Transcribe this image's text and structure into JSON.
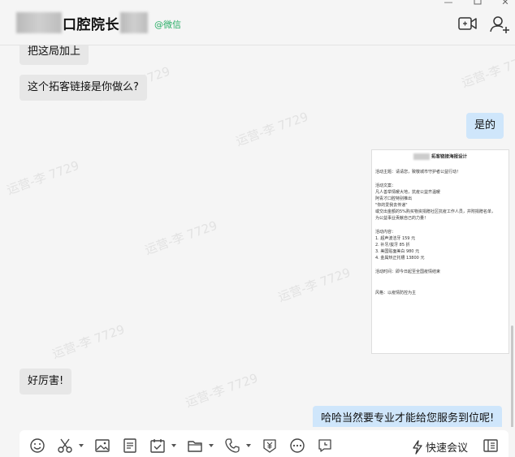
{
  "header": {
    "title": "口腔院长",
    "source_tag": "@微信"
  },
  "messages": [
    {
      "side": "left",
      "text": "把这局加上"
    },
    {
      "side": "left",
      "text": "这个拓客链接是你做么?"
    },
    {
      "side": "right",
      "text": "是的"
    },
    {
      "side": "left",
      "text": "好厉害!"
    },
    {
      "side": "right",
      "text": "哈哈当然要专业才能给您服务到位呢!"
    }
  ],
  "watermark_text": "运营-李 7729",
  "poster": {
    "title": "拓客链接海报设计",
    "theme": "活动主题：请请您，致敬城市守护者公益行动！",
    "copy_label": "活动文案：",
    "copy_lines": [
      "凡人善举情暖大地，抗疫公益齐温暖",
      "阿青才口腔特别推出",
      "\"你的爱我去传递\"",
      "或交出金额的5%购买物资捐赠社区抗疫工作人员，并附捐赠名单，",
      "为公益事业贡献自己的力量！"
    ],
    "content_label": "活动内容：",
    "items": [
      "1. 超声波洁牙   159 元",
      "2. 补牙/拔牙   85 折",
      "3. 美国贴面美白 980 元",
      "4. 金属矫正托槽   13800 元"
    ],
    "time": "活动时间：即今日起至全国疫情结束",
    "style": "风格：以疫情防控为主"
  },
  "toolbar": {
    "meeting_label": "快速会议",
    "icons": [
      "emoji-icon",
      "scissors-icon",
      "image-icon",
      "document-icon",
      "calendar-check-icon",
      "folder-icon",
      "phone-icon",
      "payment-icon",
      "more-icon",
      "chat-history-icon",
      "lightning-icon",
      "sidebar-icon"
    ]
  }
}
